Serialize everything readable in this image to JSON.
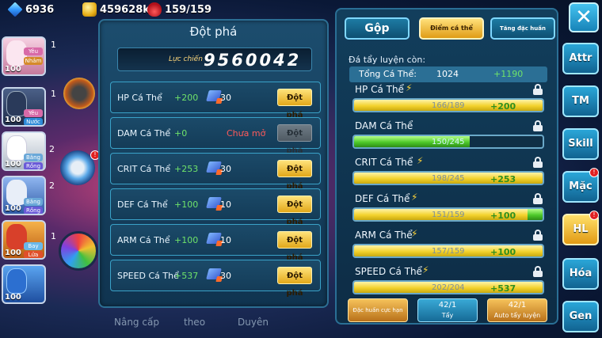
{
  "resources": {
    "diamonds": "6936",
    "gold": "459628k",
    "stamina": "159/159"
  },
  "roster": [
    {
      "level": "100",
      "tag": "Yêu",
      "tag2": "Nhảm",
      "num": "1",
      "color": "#f3c4d8"
    },
    {
      "level": "100",
      "tag": "Yêu",
      "tag2": "Nước",
      "num": "1",
      "color": "#2a3a5a"
    },
    {
      "level": "100",
      "tag": "Băng",
      "tag2": "Rồng",
      "num": "2",
      "color": "#e8eef4"
    },
    {
      "level": "100",
      "tag": "Băng",
      "tag2": "Rồng",
      "num": "2",
      "color": "#3f6fb8"
    },
    {
      "level": "100",
      "tag": "Bay",
      "tag2": "Lửa",
      "num": "1",
      "color": "#e8a640"
    },
    {
      "level": "100",
      "tag": "Nước",
      "tag2": "",
      "num": "",
      "color": "#2c6fd0"
    }
  ],
  "breakthrough": {
    "title": "Đột phá",
    "power_label": "Lực chiến",
    "power_value": "9560042",
    "rows": [
      {
        "name": "HP Cá Thể",
        "plus": "+200",
        "cost": "30",
        "button": "Đột phá",
        "locked": false
      },
      {
        "name": "DAM Cá Thể",
        "plus": "+0",
        "cost": "",
        "locked_text": "Chưa mở",
        "button": "Đột phá",
        "locked": true
      },
      {
        "name": "CRIT Cá Thể",
        "plus": "+253",
        "cost": "30",
        "button": "Đột phá",
        "locked": false
      },
      {
        "name": "DEF Cá Thể",
        "plus": "+100",
        "cost": "10",
        "button": "Đột phá",
        "locked": false
      },
      {
        "name": "ARM Cá Thể",
        "plus": "+100",
        "cost": "10",
        "button": "Đột phá",
        "locked": false
      },
      {
        "name": "SPEED Cá Thể",
        "plus": "+537",
        "cost": "30",
        "button": "Đột phá",
        "locked": false
      }
    ]
  },
  "right": {
    "tabs": {
      "gop": "Gộp",
      "diem": "Điểm cá thể",
      "tang": "Tăng đặc huấn"
    },
    "subtitle": "Đá tẩy luyện còn:",
    "total_label": "Tổng Cá Thể:",
    "total_value": "1024",
    "total_plus": "+1190",
    "stats": [
      {
        "name": "HP Cá Thể",
        "value": "166/189",
        "plus": "+200",
        "fraction": 1.0,
        "fill": "yellow",
        "bolt": true
      },
      {
        "name": "DAM Cá Thể",
        "value": "150/245",
        "plus": "",
        "fraction": 0.612,
        "fill": "green",
        "bolt": false
      },
      {
        "name": "CRIT Cá Thể",
        "value": "198/245",
        "plus": "+253",
        "fraction": 1.0,
        "fill": "yellow",
        "bolt": true
      },
      {
        "name": "DEF Cá Thể",
        "value": "151/159",
        "plus": "+100",
        "fraction": 1.0,
        "fill": "yellowgreen",
        "bolt": true
      },
      {
        "name": "ARM Cá Thể",
        "value": "157/159",
        "plus": "+100",
        "fraction": 1.0,
        "fill": "yellow",
        "bolt": true
      },
      {
        "name": "SPEED Cá Thể",
        "value": "202/204",
        "plus": "+537",
        "fraction": 1.0,
        "fill": "yellow",
        "bolt": true
      }
    ],
    "buttons": {
      "dac_huan": "Đặc huấn cực hạn",
      "tay_count": "42/1",
      "tay": "Tẩy",
      "auto_count": "42/1",
      "auto": "Auto tẩy luyện"
    }
  },
  "side_tabs": [
    "Attr",
    "TM",
    "Skill",
    "Mặc",
    "HL",
    "Hóa",
    "Gen"
  ],
  "bottom_labels": [
    "Nâng cấp",
    "theo",
    "Duyên"
  ],
  "colors": {
    "gold_button": "#e2a81a",
    "blue_panel": "#123e5c",
    "green_plus": "#6fe36a"
  }
}
